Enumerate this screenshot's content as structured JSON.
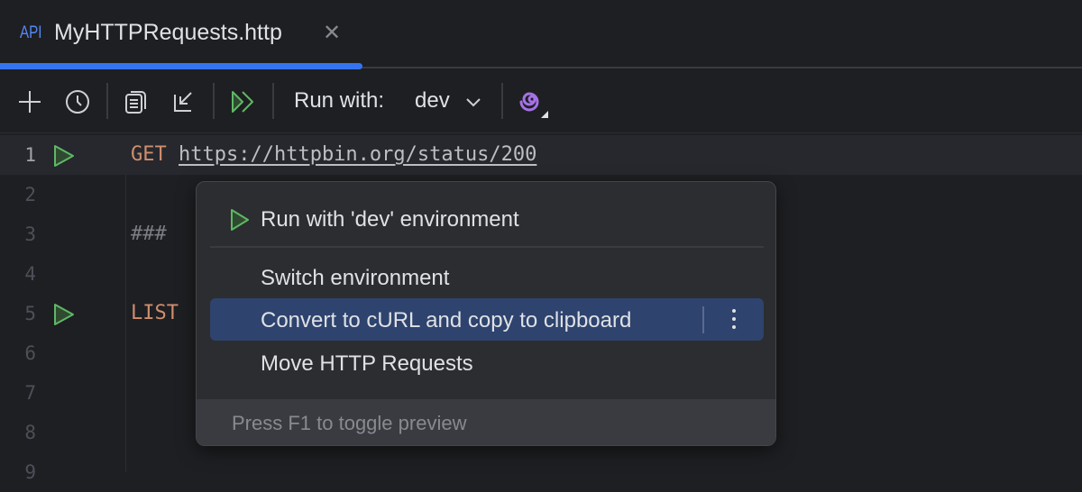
{
  "tab": {
    "icon_label": "API",
    "title": "MyHTTPRequests.http"
  },
  "toolbar": {
    "run_with_label": "Run with:",
    "environment": "dev"
  },
  "editor": {
    "lines": [
      {
        "number": "1",
        "method": "GET",
        "text": "https://httpbin.org/status/200"
      },
      {
        "number": "2",
        "method": "",
        "text": ""
      },
      {
        "number": "3",
        "method": "",
        "text": "###"
      },
      {
        "number": "4",
        "method": "",
        "text": ""
      },
      {
        "number": "5",
        "method": "LIST",
        "text": ""
      },
      {
        "number": "6",
        "method": "",
        "text": ""
      },
      {
        "number": "7",
        "method": "",
        "text": ""
      },
      {
        "number": "8",
        "method": "",
        "text": ""
      },
      {
        "number": "9",
        "method": "",
        "text": ""
      }
    ]
  },
  "popup": {
    "items": [
      {
        "label": "Run with 'dev' environment"
      },
      {
        "label": "Switch environment"
      },
      {
        "label": "Convert to cURL and copy to clipboard"
      },
      {
        "label": "Move HTTP Requests"
      }
    ],
    "footer": "Press F1 to toggle preview"
  },
  "colors": {
    "accent": "#3574f0",
    "run_green": "#5fb865",
    "selection": "#2e436e",
    "keyword": "#cf8e6d"
  }
}
